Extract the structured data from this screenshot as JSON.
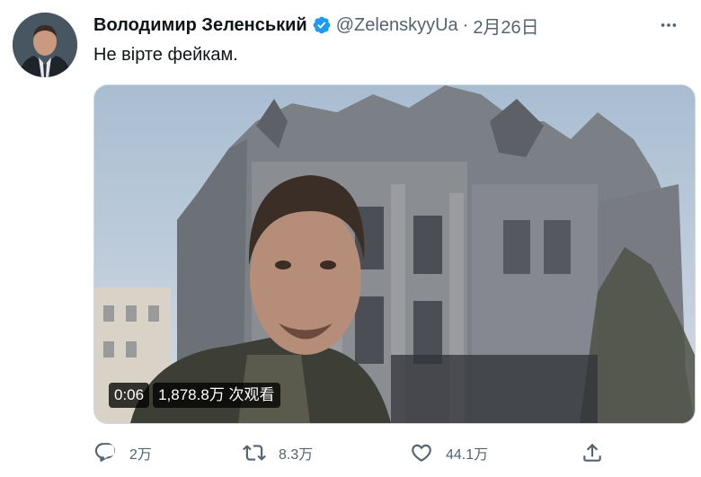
{
  "tweet": {
    "author_name": "Володимир Зеленський",
    "handle": "@ZelenskyyUa",
    "separator": "·",
    "date": "2月26日",
    "text": "Не вірте фейкам."
  },
  "video": {
    "duration": "0:06",
    "views": "1,878.8万 次观看"
  },
  "actions": {
    "replies": "2万",
    "retweets": "8.3万",
    "likes": "44.1万"
  },
  "icons": {
    "verified": "verified-badge-icon",
    "more": "more-horizontal-icon",
    "reply": "reply-icon",
    "retweet": "retweet-icon",
    "like": "heart-icon",
    "share": "share-icon"
  },
  "colors": {
    "verified": "#1d9bf0",
    "text": "#0f1419",
    "muted": "#536471"
  }
}
